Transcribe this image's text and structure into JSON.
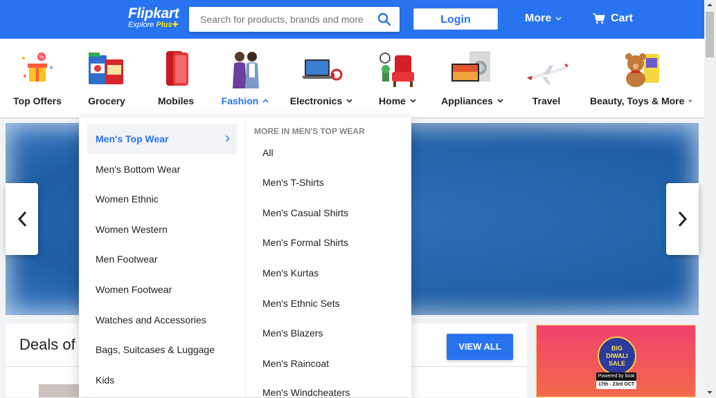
{
  "header": {
    "logo_text": "Flipkart",
    "logo_sub": "Explore",
    "logo_plus": "Plus",
    "search": {
      "placeholder": "Search for products, brands and more"
    },
    "login_label": "Login",
    "more_label": "More",
    "cart_label": "Cart",
    "brand_color": "#2874f0"
  },
  "categories": [
    {
      "label": "Top Offers",
      "icon": "gift-icon"
    },
    {
      "label": "Grocery",
      "icon": "grocery-icon"
    },
    {
      "label": "Mobiles",
      "icon": "mobile-phone-icon"
    },
    {
      "label": "Fashion",
      "icon": "fashion-models-icon",
      "active": true
    },
    {
      "label": "Electronics",
      "icon": "laptop-icon"
    },
    {
      "label": "Home",
      "icon": "armchair-icon"
    },
    {
      "label": "Appliances",
      "icon": "tv-washer-icon"
    },
    {
      "label": "Travel",
      "icon": "airplane-icon"
    },
    {
      "label": "Beauty, Toys & More",
      "icon": "teddy-bear-icon"
    }
  ],
  "dropdown": {
    "left_items": [
      "Men's Top Wear",
      "Men's Bottom Wear",
      "Women Ethnic",
      "Women Western",
      "Men Footwear",
      "Women Footwear",
      "Watches and Accessories",
      "Bags, Suitcases & Luggage",
      "Kids"
    ],
    "active_index": 0,
    "heading": "MORE IN MEN'S TOP WEAR",
    "sub_items": [
      "All",
      "Men's T-Shirts",
      "Men's Casual Shirts",
      "Men's Formal Shirts",
      "Men's Kurtas",
      "Men's Ethnic Sets",
      "Men's Blazers",
      "Men's Raincoat",
      "Men's Windcheaters"
    ]
  },
  "deals": {
    "title": "Deals of t",
    "view_all_label": "VIEW ALL"
  },
  "promo": {
    "badge_line1": "BIG",
    "badge_line2": "DIWALI",
    "badge_line3": "SALE",
    "powered": "Powered by boat",
    "dates": "17th - 23rd OCT"
  }
}
